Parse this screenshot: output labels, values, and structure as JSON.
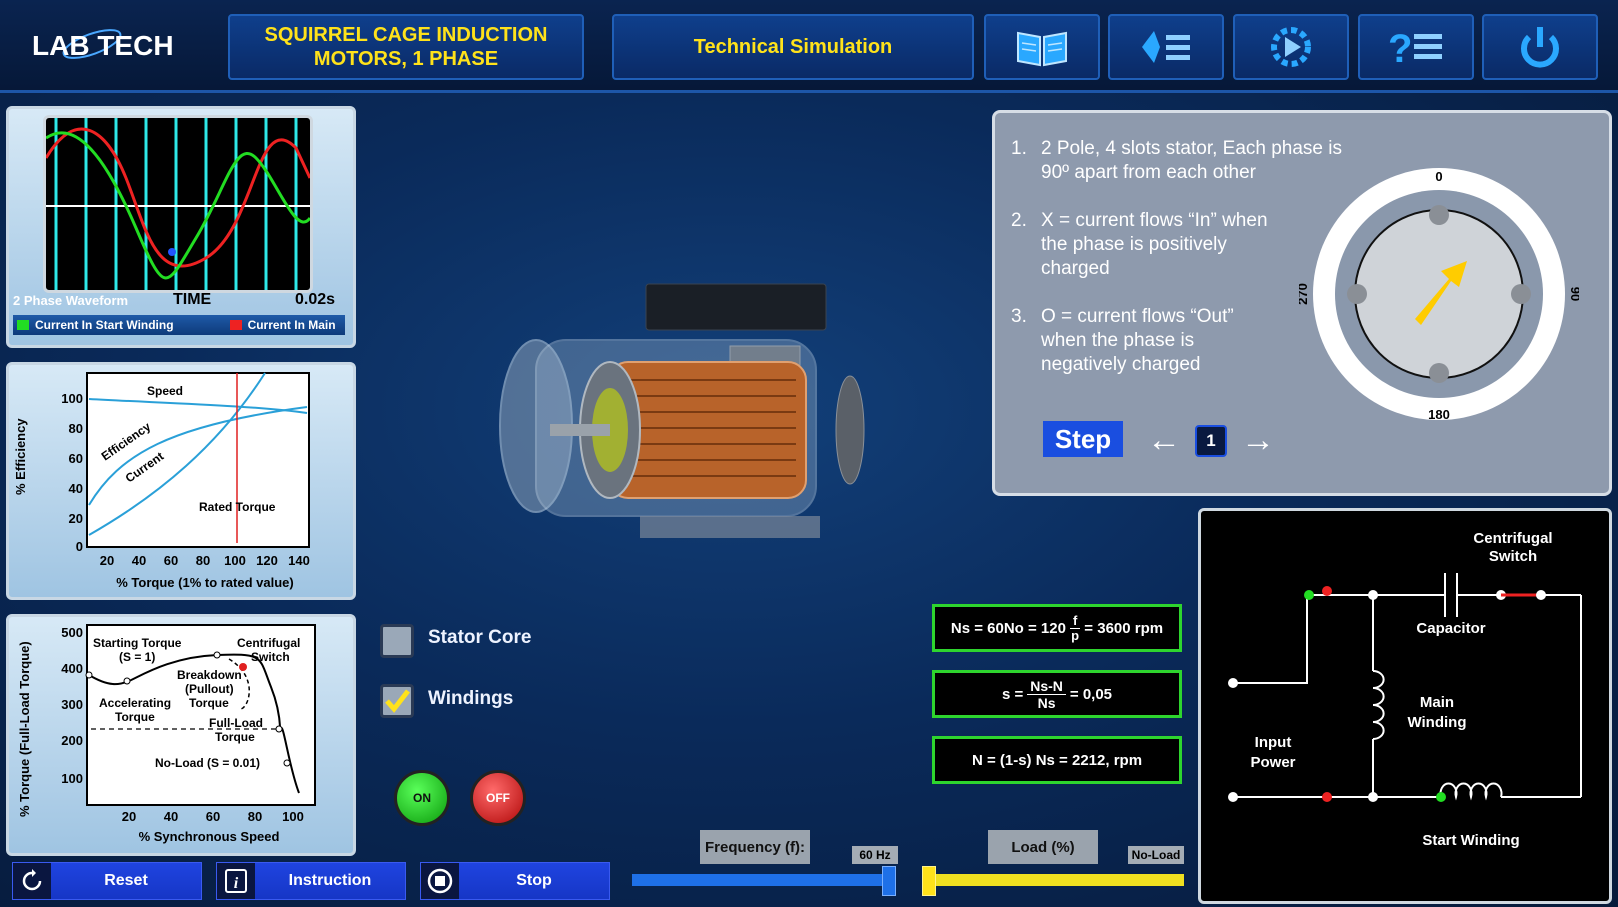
{
  "header": {
    "logo": "LAB TECH",
    "title_line1": "SQUIRREL CAGE INDUCTION",
    "title_line2": "MOTORS, 1 PHASE",
    "simulation_label": "Technical Simulation",
    "icons": [
      "book-icon",
      "list-icon",
      "play-gear-icon",
      "help-list-icon",
      "power-icon"
    ]
  },
  "waveform_panel": {
    "title": "2 Phase Waveform",
    "axis_label": "TIME",
    "time_value": "0.02s",
    "legend_start": "Current In Start Winding",
    "legend_main": "Current In Main",
    "colors": {
      "start": "#22dd22",
      "main": "#ee2222"
    }
  },
  "efficiency_chart": {
    "ylabel": "% Efficiency",
    "xlabel": "% Torque (1% to rated value)",
    "y_ticks": [
      "0",
      "20",
      "40",
      "60",
      "80",
      "100"
    ],
    "x_ticks": [
      "20",
      "40",
      "60",
      "80",
      "100",
      "120",
      "140"
    ],
    "labels": {
      "speed": "Speed",
      "efficiency": "Efficiency",
      "current": "Current",
      "rated": "Rated Torque"
    }
  },
  "torque_chart": {
    "ylabel": "% Torque (Full-Load Torque)",
    "xlabel": "% Synchronous Speed",
    "y_ticks": [
      "100",
      "200",
      "300",
      "400",
      "500"
    ],
    "x_ticks": [
      "20",
      "40",
      "60",
      "80",
      "100"
    ],
    "annotations": {
      "starting": "Starting Torque",
      "starting_s": "(S = 1)",
      "centrifugal": "Centrifugal",
      "switch": "Switch",
      "breakdown": "Breakdown",
      "pullout": "(Pullout)",
      "torque": "Torque",
      "accelerating": "Accelerating",
      "acc_torque": "Torque",
      "fullload": "Full-Load",
      "fl_torque": "Torque",
      "noload": "No-Load (S = 0.01)"
    }
  },
  "components": {
    "stator_core": {
      "label": "Stator Core",
      "checked": false
    },
    "windings": {
      "label": "Windings",
      "checked": true
    }
  },
  "power_buttons": {
    "on": "ON",
    "off": "OFF"
  },
  "steps": {
    "items": [
      {
        "num": "1.",
        "line1": "2 Pole, 4 slots stator, Each phase is",
        "line2": "90º apart from each other"
      },
      {
        "num": "2.",
        "line1": "X = current flows “In” when",
        "line2": "the phase is positively",
        "line3": "charged"
      },
      {
        "num": "3.",
        "line1": "O = current flows “Out”",
        "line2": "when the phase is",
        "line3": "negatively charged"
      }
    ],
    "step_label": "Step",
    "current_step": "1"
  },
  "dial": {
    "top": "0",
    "right": "90",
    "bottom": "180",
    "left": "270"
  },
  "formulas": {
    "ns_prefix": "Ns = 60No = 120",
    "ns_frac_num": "f",
    "ns_frac_den": "p",
    "ns_suffix": "=  3600 rpm",
    "s_prefix": "s =",
    "s_frac_num": "Ns-N",
    "s_frac_den": "Ns",
    "s_suffix": "= 0,05",
    "n_formula": "N = (1-s) Ns = 2212,   rpm"
  },
  "circuit": {
    "centrifugal": "Centrifugal",
    "switch": "Switch",
    "capacitor": "Capacitor",
    "main": "Main",
    "winding": "Winding",
    "input": "Input",
    "power": "Power",
    "start_winding": "Start Winding"
  },
  "controls": {
    "frequency_label": "Frequency (f):",
    "frequency_value": "60 Hz",
    "frequency_level": 1.0,
    "load_label": "Load (%)",
    "load_value": "No-Load",
    "load_level": 0.0
  },
  "bottom": {
    "reset": "Reset",
    "instruction": "Instruction",
    "stop": "Stop"
  }
}
